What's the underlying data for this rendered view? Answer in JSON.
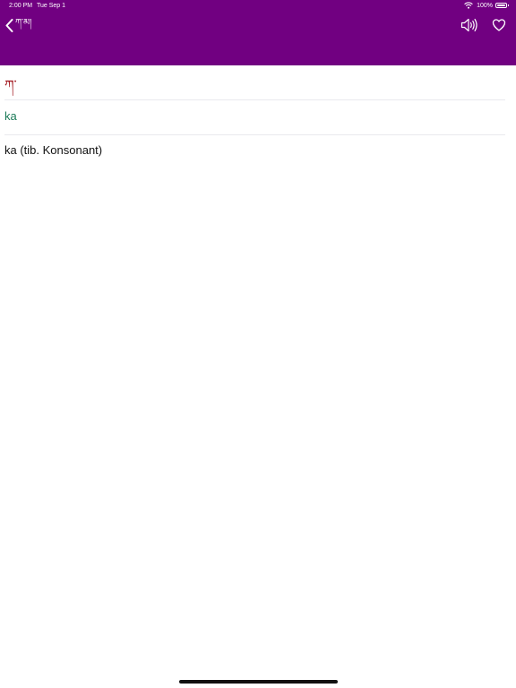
{
  "status_bar": {
    "time": "2:00 PM",
    "date": "Tue Sep 1",
    "battery": "100%"
  },
  "nav": {
    "back_label": "ཀ་མ།",
    "background_color": "#710081"
  },
  "entry": {
    "tibetan": "ཀ་",
    "romanization": "ka",
    "translation": "ka (tib. Konsonant)"
  },
  "icons": {
    "back": "chevron-left-icon",
    "speaker": "speaker-icon",
    "favorite": "heart-icon",
    "wifi": "wifi-icon",
    "battery": "battery-icon"
  }
}
